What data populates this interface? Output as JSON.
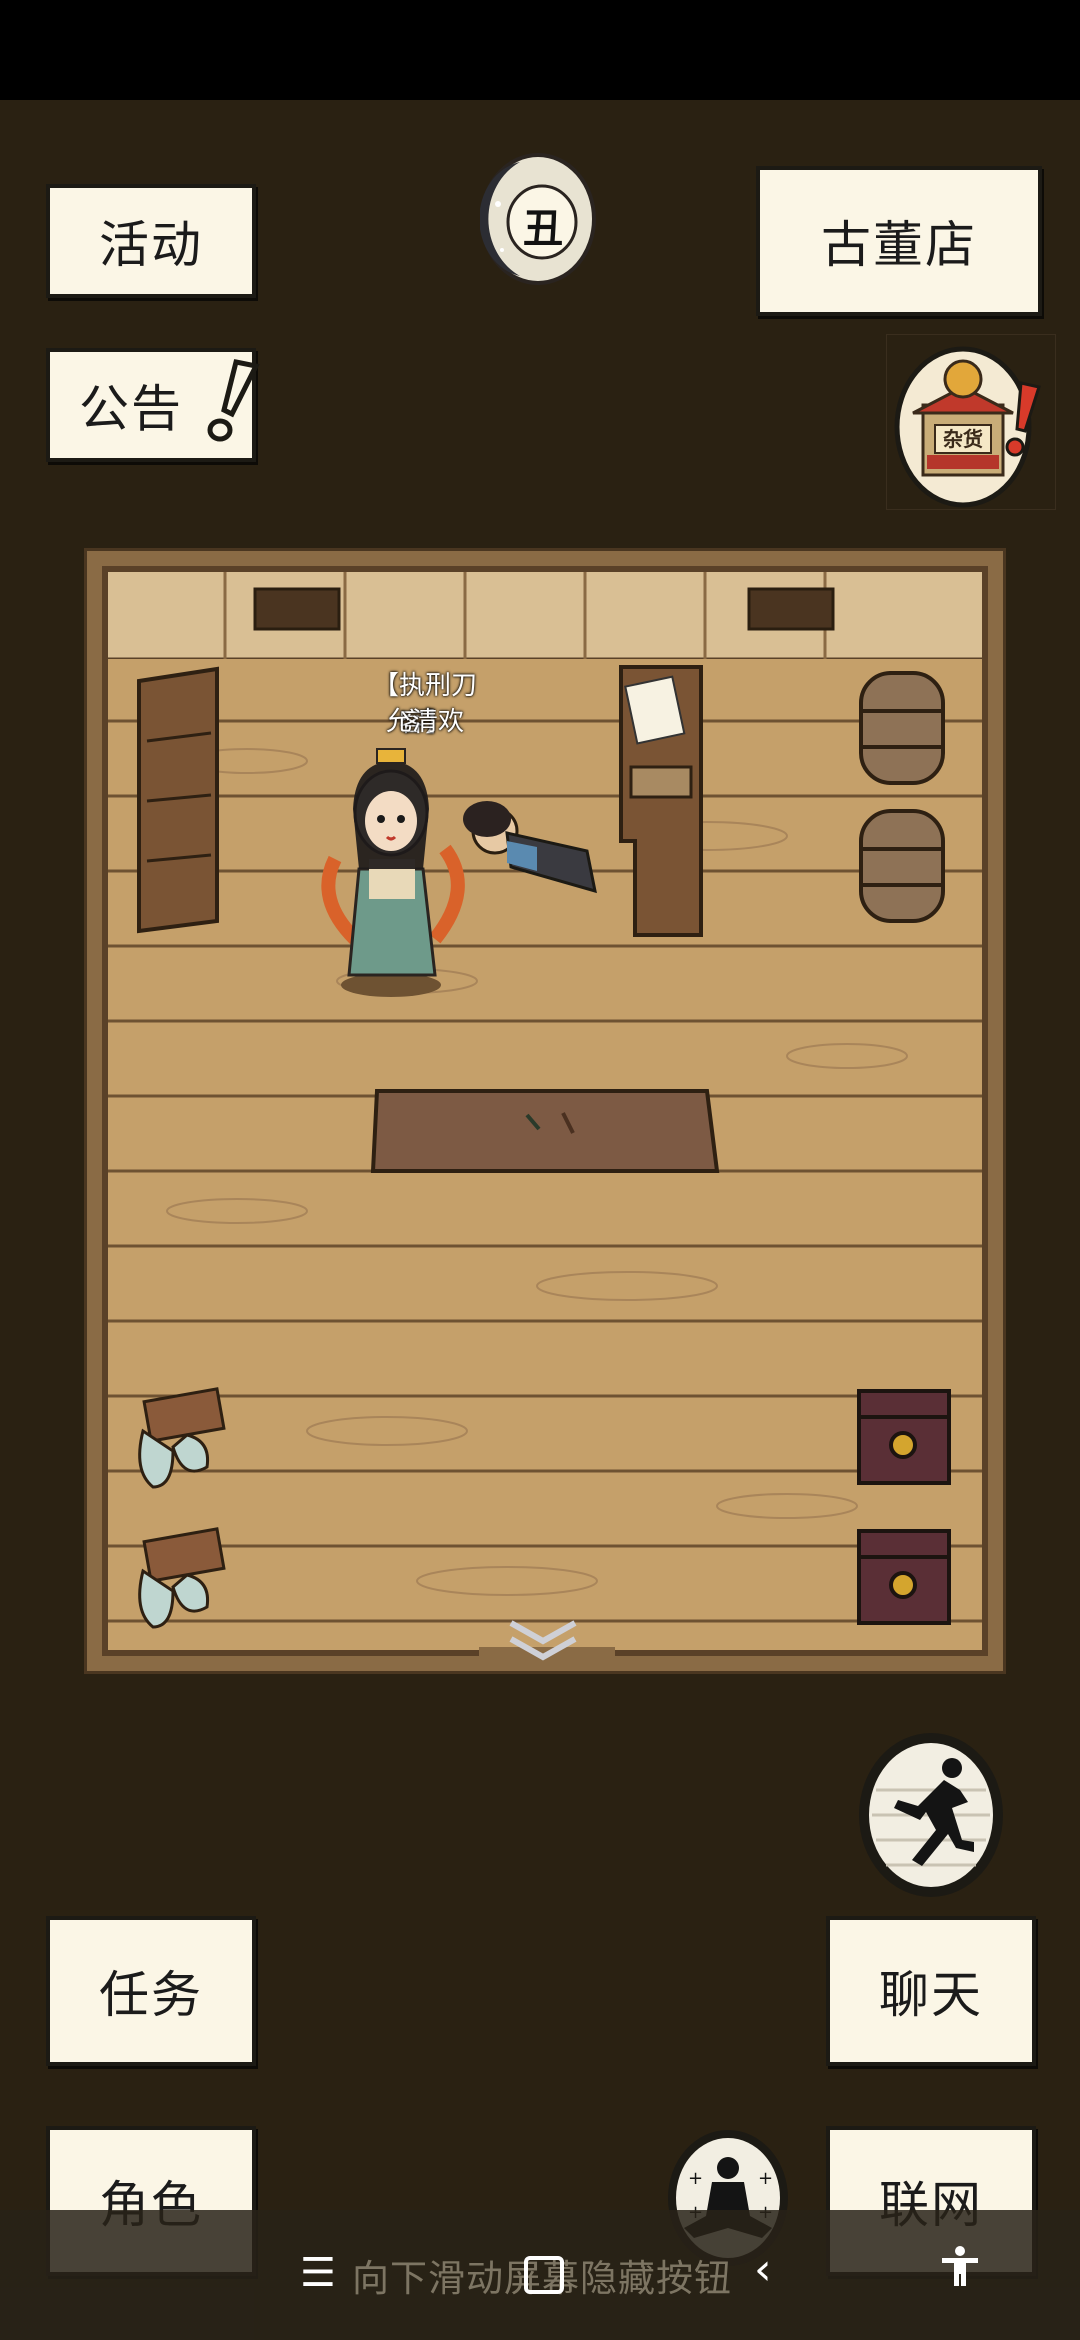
{
  "buttons": {
    "activity": "活动",
    "notice": "公告",
    "antique_shop": "古董店",
    "task": "任务",
    "chat": "聊天",
    "character": "角色",
    "online": "联网"
  },
  "time_badge": "丑",
  "shop_sign": "杂货",
  "npc": {
    "title": "【执刑刀客】",
    "name": "允清欢"
  },
  "navbar": {
    "hint": "向下滑动屏幕隐藏按钮"
  }
}
